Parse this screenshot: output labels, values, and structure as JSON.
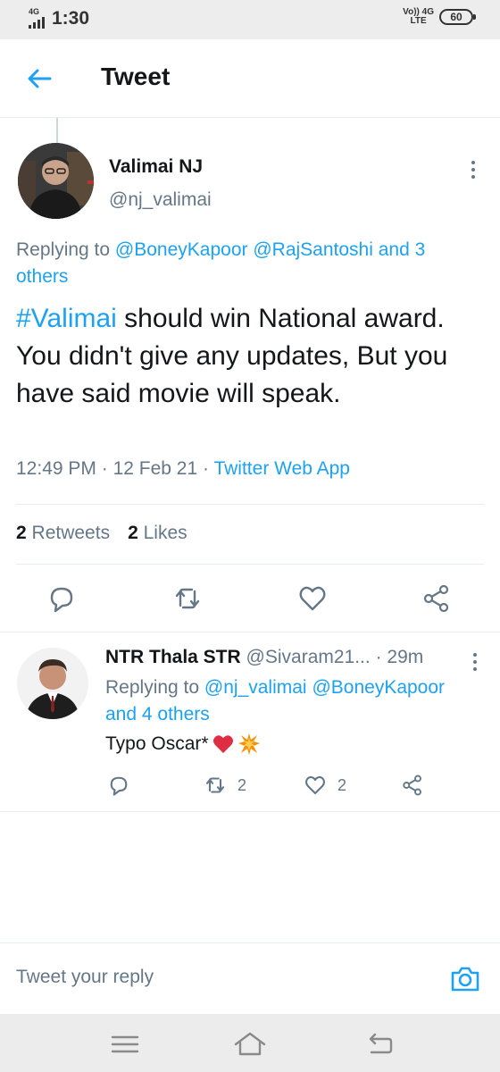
{
  "status_bar": {
    "network": "4G",
    "time": "1:30",
    "volte_top": "Vo)) 4G",
    "volte_bottom": "LTE",
    "battery": "60"
  },
  "header": {
    "title": "Tweet",
    "back_icon": "arrow-left-icon"
  },
  "main_tweet": {
    "author_name": "Valimai NJ",
    "author_handle": "@nj_valimai",
    "replying_prefix": "Replying to ",
    "replying_mention_1": "@BoneyKapoor",
    "replying_mention_2": "@RajSantoshi",
    "replying_others": "and 3 others",
    "hashtag": "#Valimai",
    "text": " should win National award. You didn't give any updates, But you have said movie will speak.",
    "time": "12:49 PM",
    "date": "12 Feb 21",
    "separator": "·",
    "app": "Twitter Web App",
    "retweets_count": "2",
    "retweets_label": "Retweets",
    "likes_count": "2",
    "likes_label": "Likes"
  },
  "reply_tweet": {
    "author_name": "NTR Thala STR",
    "author_handle": "@Sivaram21...",
    "time": "· 29m",
    "replying_prefix": "Replying to ",
    "replying_mention_1": "@nj_valimai",
    "replying_mention_2": "@BoneyKapoor",
    "replying_others": "and 4 others",
    "text": "Typo Oscar*",
    "retweet_count": "2",
    "like_count": "2"
  },
  "composer": {
    "placeholder": "Tweet your reply"
  },
  "colors": {
    "accent": "#1da1f2",
    "secondary_text": "#657786",
    "primary_text": "#14171a",
    "divider": "#e6ecf0"
  },
  "icons": [
    "arrow-left-icon",
    "more-vertical-icon",
    "reply-icon",
    "retweet-icon",
    "like-icon",
    "share-icon",
    "camera-icon",
    "menu-icon",
    "home-icon",
    "back-nav-icon",
    "heart-emoji",
    "collision-emoji"
  ]
}
